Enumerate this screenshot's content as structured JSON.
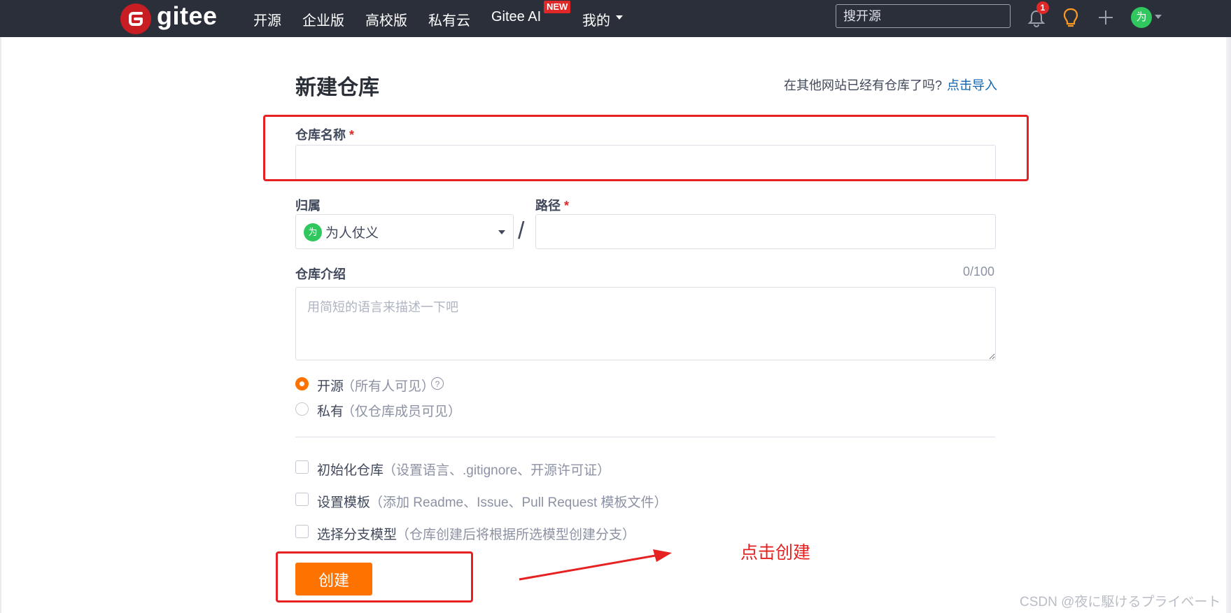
{
  "nav": {
    "logo_text": "gitee",
    "items": [
      "开源",
      "企业版",
      "高校版",
      "私有云",
      "Gitee AI",
      "我的"
    ],
    "new_badge": "NEW",
    "search_placeholder": "搜开源",
    "notification_count": "1",
    "avatar_char": "为",
    "icons": [
      "gitee-logo-icon",
      "bell-icon",
      "lightbulb-icon",
      "plus-icon",
      "chevron-down-icon"
    ]
  },
  "form": {
    "title": "新建仓库",
    "import_question": "在其他网站已经有仓库了吗?",
    "import_link": "点击导入",
    "repo_name_label": "仓库名称",
    "required_mark": "*",
    "repo_name_value": "",
    "owner_label": "归属",
    "owner_avatar_char": "为",
    "owner_value": "为人仗义",
    "path_label": "路径",
    "path_value": "",
    "slash": "/",
    "desc_label": "仓库介绍",
    "desc_counter": "0/100",
    "desc_placeholder": "用简短的语言来描述一下吧",
    "visibility": [
      {
        "label": "开源",
        "hint": "（所有人可见）",
        "selected": true,
        "help": "?"
      },
      {
        "label": "私有",
        "hint": "（仅仓库成员可见）",
        "selected": false
      }
    ],
    "options": [
      {
        "label": "初始化仓库",
        "hint": "（设置语言、.gitignore、开源许可证）",
        "checked": false
      },
      {
        "label": "设置模板",
        "hint": "（添加 Readme、Issue、Pull Request 模板文件）",
        "checked": false
      },
      {
        "label": "选择分支模型",
        "hint": "（仓库创建后将根据所选模型创建分支）",
        "checked": false
      }
    ],
    "create_button": "创建"
  },
  "annotation": {
    "text": "点击创建",
    "color": "#e52121"
  },
  "watermark": "CSDN @夜に駆けるプライベート",
  "colors": {
    "nav_bg": "#2a2f3a",
    "accent": "#fe7300",
    "link": "#0f64b4",
    "required": "#db2828",
    "brand": "#c71d23"
  }
}
